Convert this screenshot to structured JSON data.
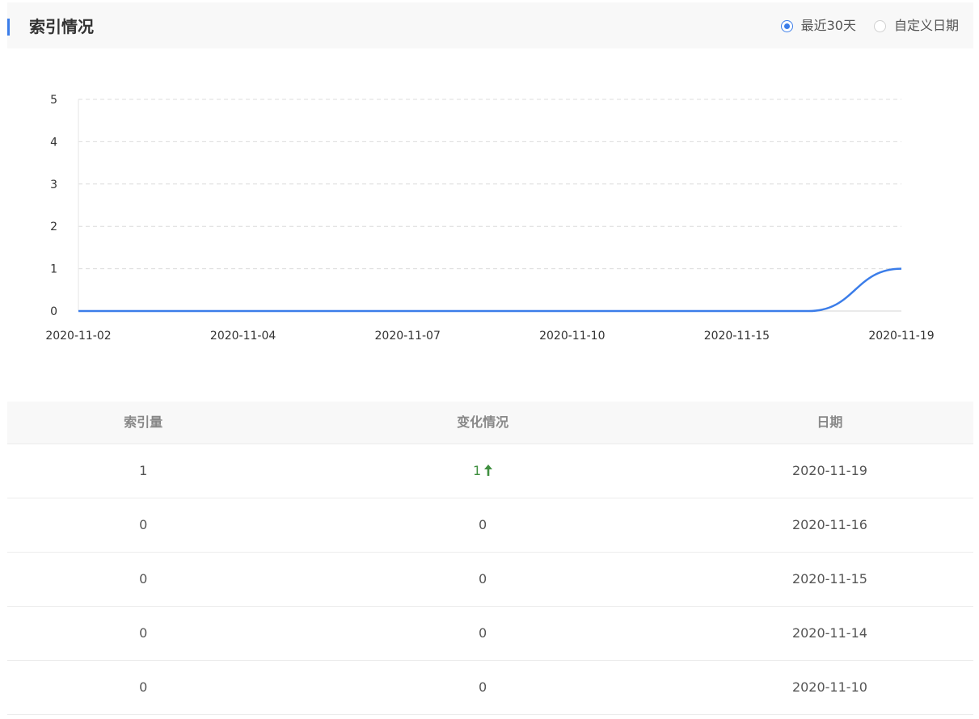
{
  "header": {
    "title": "索引情况",
    "accent_color": "#3b7de9",
    "range_options": [
      {
        "label": "最近30天",
        "checked": true
      },
      {
        "label": "自定义日期",
        "checked": false
      }
    ]
  },
  "chart_data": {
    "type": "line",
    "x_ticks": [
      "2020-11-02",
      "2020-11-04",
      "2020-11-07",
      "2020-11-10",
      "2020-11-15",
      "2020-11-19"
    ],
    "y_ticks": [
      "0",
      "1",
      "2",
      "3",
      "4",
      "5"
    ],
    "ylim": [
      0,
      5
    ],
    "grid": true,
    "series": [
      {
        "color": "#3b7de9",
        "x": [
          "2020-11-02",
          "2020-11-04",
          "2020-11-07",
          "2020-11-10",
          "2020-11-14",
          "2020-11-15",
          "2020-11-16",
          "2020-11-19"
        ],
        "values": [
          0,
          0,
          0,
          0,
          0,
          0,
          0,
          1
        ]
      }
    ]
  },
  "table": {
    "headers": [
      "索引量",
      "变化情况",
      "日期"
    ],
    "rows": [
      {
        "count": "1",
        "change": "1",
        "trend": "up",
        "date": "2020-11-19"
      },
      {
        "count": "0",
        "change": "0",
        "trend": "none",
        "date": "2020-11-16"
      },
      {
        "count": "0",
        "change": "0",
        "trend": "none",
        "date": "2020-11-15"
      },
      {
        "count": "0",
        "change": "0",
        "trend": "none",
        "date": "2020-11-14"
      },
      {
        "count": "0",
        "change": "0",
        "trend": "none",
        "date": "2020-11-10"
      }
    ],
    "up_color": "#3f8f3f"
  }
}
